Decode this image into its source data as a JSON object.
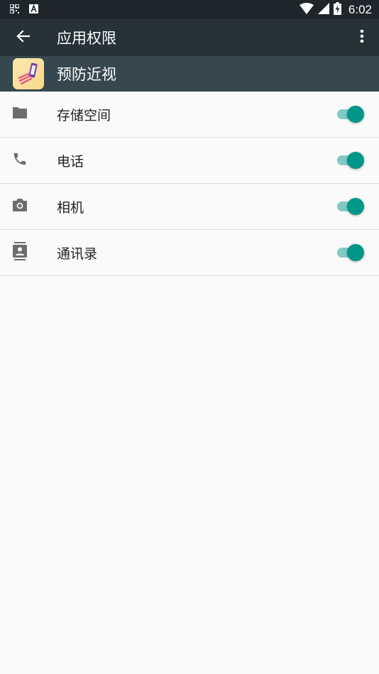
{
  "status_bar": {
    "time": "6:02",
    "icons": [
      "qr-icon",
      "a-icon",
      "wifi-icon",
      "signal-icon",
      "battery-charging-icon"
    ]
  },
  "toolbar": {
    "title": "应用权限"
  },
  "app": {
    "name": "预防近视"
  },
  "permissions": [
    {
      "label": "存储空间",
      "icon": "folder-icon",
      "enabled": true
    },
    {
      "label": "电话",
      "icon": "phone-icon",
      "enabled": true
    },
    {
      "label": "相机",
      "icon": "camera-icon",
      "enabled": true
    },
    {
      "label": "通讯录",
      "icon": "contacts-icon",
      "enabled": true
    }
  ],
  "colors": {
    "status_bar": "#1f262b",
    "toolbar": "#263238",
    "app_header": "#37474f",
    "accent": "#009688"
  }
}
